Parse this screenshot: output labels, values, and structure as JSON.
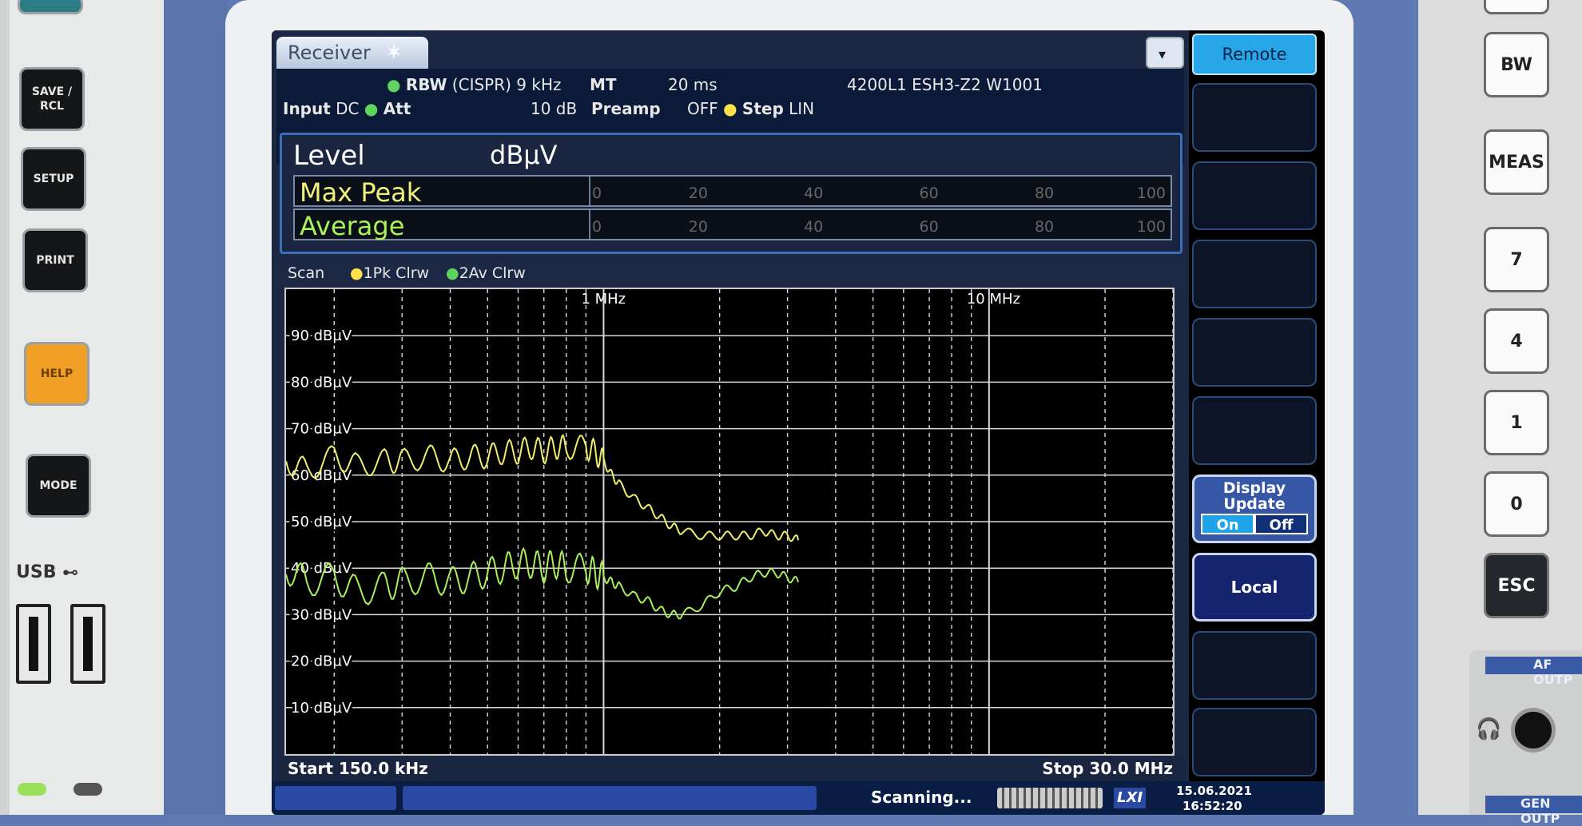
{
  "hardware_left": {
    "buttons": [
      "SAVE / RCL",
      "SETUP",
      "PRINT",
      "HELP",
      "MODE"
    ],
    "usb_label": "USB"
  },
  "hardware_right": {
    "buttons": [
      "BW",
      "MEAS",
      "7",
      "4",
      "1",
      "0",
      "ESC"
    ],
    "section_labels": [
      "AF OUTP",
      "GEN OUTP"
    ]
  },
  "screen": {
    "tab_label": "Receiver",
    "header": {
      "rbw_label": "RBW",
      "rbw_value": "(CISPR) 9 kHz",
      "mt_label": "MT",
      "mt_value": "20 ms",
      "transducer": "4200L1 ESH3-Z2 W1001",
      "input_label": "Input",
      "input_value": "DC",
      "att_label": "Att",
      "att_value": "10 dB",
      "preamp_label": "Preamp",
      "preamp_value": "OFF",
      "step_label": "Step",
      "step_value": "LIN"
    },
    "level": {
      "title": "Level",
      "unit": "dBµV",
      "bars": [
        {
          "name": "Max Peak",
          "color": "#f1f07a"
        },
        {
          "name": "Average",
          "color": "#a8f25a"
        }
      ],
      "scale_ticks": [
        "0",
        "20",
        "40",
        "60",
        "80",
        "100"
      ]
    },
    "scan": {
      "title": "Scan",
      "traces": [
        "1Pk Clrw",
        "2Av Clrw"
      ],
      "start": "Start 150.0 kHz",
      "stop": "Stop 30.0 MHz"
    },
    "softkeys": {
      "remote": "Remote",
      "display_update": "Display Update",
      "on": "On",
      "off": "Off",
      "local": "Local"
    },
    "status": {
      "text": "Scanning...",
      "logo": "LXI",
      "date": "15.06.2021",
      "time": "16:52:20"
    }
  },
  "chart_data": {
    "type": "line",
    "title": "",
    "xlabel": "",
    "ylabel": "",
    "x_scale": "log",
    "xlim_hz": [
      150000,
      30000000
    ],
    "ylim": [
      0,
      100
    ],
    "x_tick_labels": [
      {
        "hz": 1000000,
        "label": "1 MHz"
      },
      {
        "hz": 10000000,
        "label": "10 MHz"
      }
    ],
    "y_ticks": [
      10,
      20,
      30,
      40,
      50,
      60,
      70,
      80,
      90
    ],
    "y_tick_labels": [
      "10 dBµV",
      "20 dBµV",
      "30 dBµV",
      "40 dBµV",
      "50 dBµV",
      "60 dBµV",
      "70 dBµV",
      "80 dBµV",
      "90 dBµV"
    ],
    "grid": true,
    "series": [
      {
        "name": "1Pk Clrw",
        "color": "#efee6e",
        "x_hz": [
          150000,
          170000,
          200000,
          230000,
          270000,
          300000,
          350000,
          400000,
          450000,
          500000,
          550000,
          600000,
          650000,
          700000,
          750000,
          800000,
          900000,
          950000,
          1000000,
          1050000,
          1100000,
          1200000,
          1300000,
          1400000,
          1500000,
          1600000,
          1800000,
          2000000,
          2200000,
          2400000,
          2600000,
          2800000,
          3000000,
          3200000
        ],
        "y": [
          63,
          61,
          64,
          62,
          63,
          63,
          64,
          63,
          64,
          64,
          65,
          65,
          66,
          65,
          66,
          66,
          66,
          65,
          63,
          60,
          58,
          55,
          53,
          51,
          49,
          48,
          47,
          47,
          47,
          47,
          48,
          47,
          47,
          46
        ]
      },
      {
        "name": "2Av Clrw",
        "color": "#a9ee5b",
        "x_hz": [
          150000,
          170000,
          200000,
          230000,
          270000,
          300000,
          350000,
          400000,
          450000,
          500000,
          550000,
          600000,
          650000,
          700000,
          750000,
          800000,
          900000,
          950000,
          1000000,
          1050000,
          1100000,
          1200000,
          1300000,
          1400000,
          1500000,
          1600000,
          1800000,
          2000000,
          2200000,
          2400000,
          2600000,
          2800000,
          3000000,
          3200000
        ],
        "y": [
          40,
          37,
          38,
          35,
          36,
          37,
          38,
          37,
          38,
          39,
          40,
          41,
          41,
          40,
          41,
          40,
          40,
          39,
          38,
          37,
          36,
          34,
          33,
          31,
          30,
          30,
          32,
          35,
          36,
          38,
          39,
          39,
          38,
          37
        ]
      }
    ]
  }
}
